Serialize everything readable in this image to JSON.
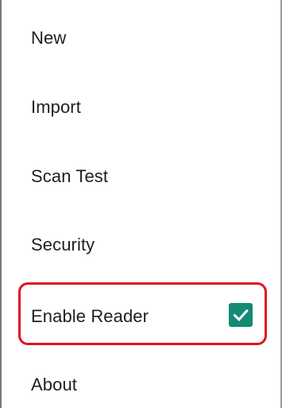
{
  "menu": {
    "items": [
      {
        "label": "New"
      },
      {
        "label": "Import"
      },
      {
        "label": "Scan Test"
      },
      {
        "label": "Security"
      },
      {
        "label": "Enable Reader",
        "checked": true
      },
      {
        "label": "About"
      }
    ]
  },
  "colors": {
    "checkbox_fill": "#138a73",
    "highlight_border": "#e0141e",
    "text": "#1f1f1f"
  },
  "icons": {
    "enable_reader_checkbox": "checkmark-icon"
  }
}
